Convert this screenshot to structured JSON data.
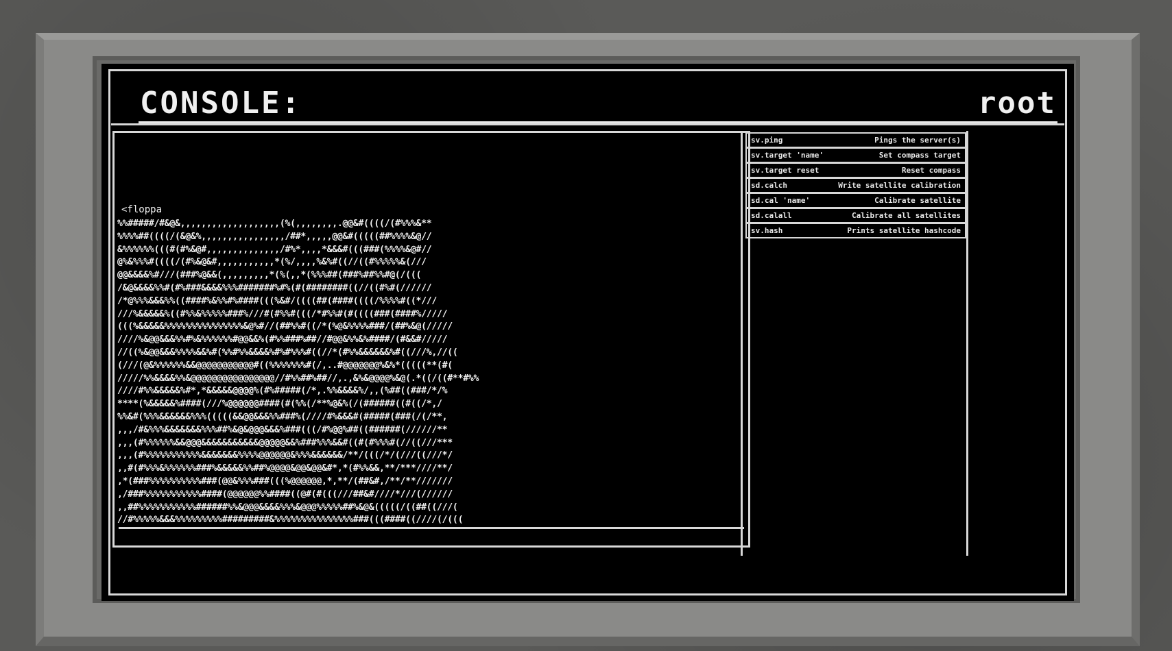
{
  "header": {
    "title": "CONSOLE:",
    "user": "root"
  },
  "console": {
    "prompt": "<floppa",
    "output_lines": [
      "%%#####/#&@&,,,,,,,,,,,,,,,,,,,(%(,,,,,,,,.@@&#((((/(#%%%&**",
      "%%%%##((((/(&@&%,,,,,,,,,,,,,,,,/##*,,,,,@@&#(((((##%%%%&@//",
      "&%%%%%%(((#(#%&@#,,,,,,,,,,,,,,/#%*,,,,*&&&#(((###(%%%%&@#//",
      "@%&%%%#((((/(#%&@&#,,,,,,,,,,,*(%/,,,,%&%#((//((#%%%%%&(///",
      "@@&&&&%#///(###%@&&(,,,,,,,,,*(%(,,*(%%%##(###%##%%#@(/(((",
      "/&@&&&&%%#(#%###&&&&%%%#######%#%(#(########((//((#%#(//////",
      "/*@%%%&&&%%((####%&%%#%####(((%&#/((((##(####((((/%%%%#((*///",
      "///%&&&&&%((#%%&%%%%%###%///#(#%%#(((/*#%%#(#((((###(####%/////",
      "(((%&&&&&%%%%%%%%%%%%%%%&@%#//(##%%#((/*(%@&%%%%###/(##%&@(/////",
      "////%&@@&&&%%#%&%%%%%%#@@&&%(#%%###%##//#@@&%%&%####/(#&&#/////",
      "//((%&@@&&&%%%%&&%#(%%#%%&&&&%#%#%%%#((//*(#%%&&&&&&%#((///%,//((",
      "(///(@&%%%%%%&&@@@@@@@@@@@#((%%%%%%%#(/,..#@@@@@@@%&%*(((((**(#(",
      "/////%%&&&&%%&@@@@@@@@@@@@@@@@//#%%##%##//,.,&%&@@@@%&@(.*((/((#**#%%",
      "////#%%&&&&&%#*,*&&&&&@@@@%(#%#####(/*,.%%&&&&%/,,(%##((###/*/%",
      "****(%&&&&&%####(///%@@@@@@####(#(%%(/**%@&%(/(######((#((/*,/",
      "%%&#(%%%&&&&&&%%%(((((&&@@&&&%%###%(////#%&&&#(#####(###(/(/**,",
      ",,,/#&%%%&&&&&&&%%%##%&@&@@@&&&%###(((/#%@@%##((######(//////**",
      ",,,(#%%%%%%&&@@@&&&&&&&&&&&@@@@@&&%###%%%&&#((#(#%%%#(//((///***",
      ",,,(#%%%%%%%%%%%&&&&&&&%%%%@@@@@@&%%%&&&&&&/**/(((/*/(///((///*/",
      ",,#(#%%%&%%%%%%###%&&&&&%%##%@@@@&@@&@@&#*,*(#%%&&,**/***////**/",
      ",*(###%%%%%%%%%%###(@@&%%%###(((%@@@@@@,*,**/(##&#,/**/**///////",
      ",/###%%%%%%%%%%%####(@@@@@@%%####((@#(#(((///##&#////*///(//////",
      ",,##%%%%%%%%%%%######%%&@@@&&&&%%%&@@@%%%%%##%&@&(((((/((##((///(",
      "//#%%%%%&&&%%%%%%%%%#########&%%%%%%%%%%%%%%%###(((####((////(/((("
    ]
  },
  "commands": [
    {
      "name": "sv.ping",
      "desc": "Pings the server(s)"
    },
    {
      "name": "sv.target 'name'",
      "desc": "Set compass target"
    },
    {
      "name": "sv.target reset",
      "desc": "Reset compass"
    },
    {
      "name": "sd.calch",
      "desc": "Write satellite calibration"
    },
    {
      "name": "sd.cal 'name'",
      "desc": "Calibrate satellite"
    },
    {
      "name": "sd.calall",
      "desc": "Calibrate all satellites"
    },
    {
      "name": "sv.hash",
      "desc": "Prints satellite hashcode"
    }
  ]
}
